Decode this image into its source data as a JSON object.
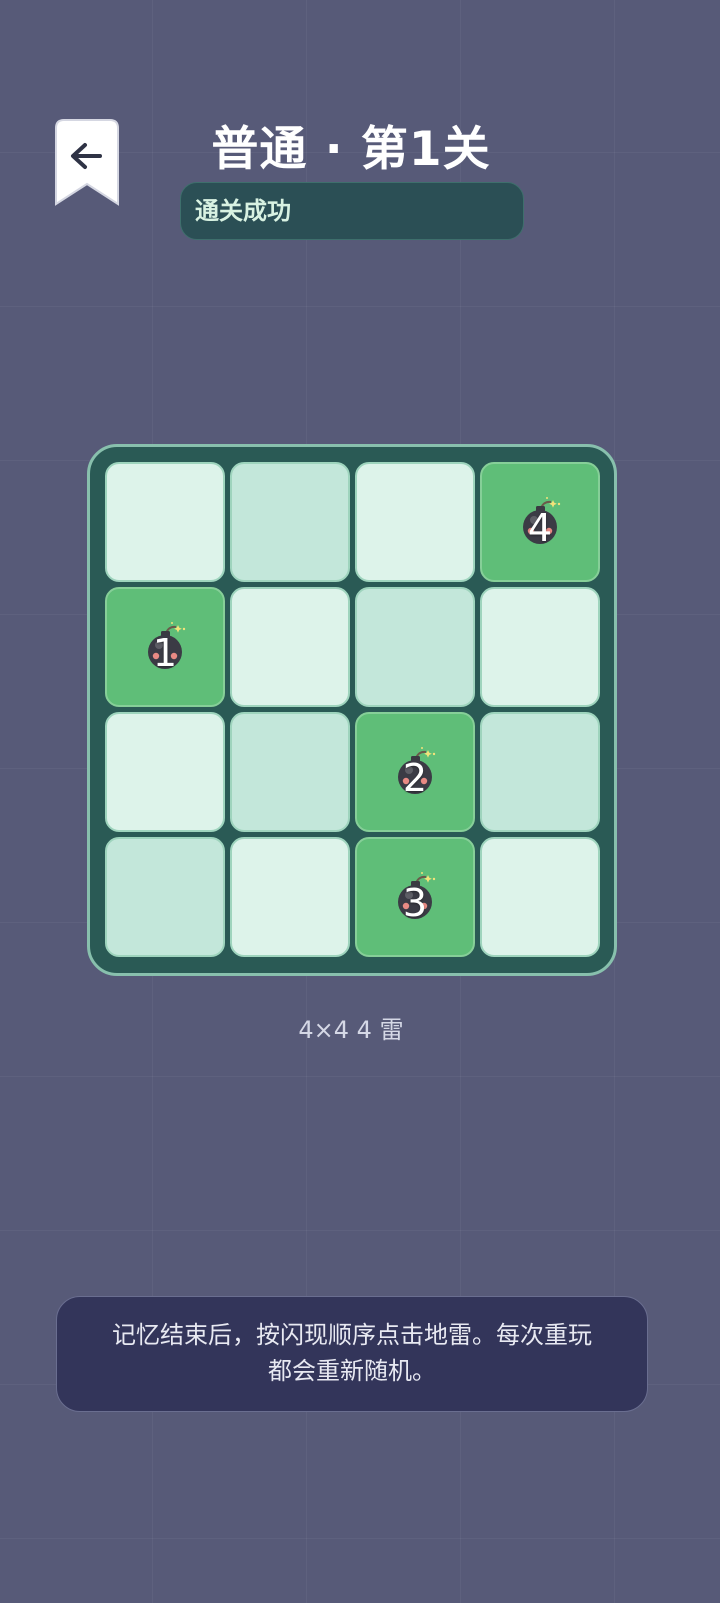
{
  "header": {
    "back_icon": "arrow-left-icon",
    "title": "普通 · 第1关",
    "status": "通关成功"
  },
  "board": {
    "rows": 4,
    "cols": 4,
    "cells": [
      [
        {
          "tone": "light"
        },
        {
          "tone": "mid"
        },
        {
          "tone": "light"
        },
        {
          "tone": "mine",
          "order": "4"
        }
      ],
      [
        {
          "tone": "mine",
          "order": "1"
        },
        {
          "tone": "light"
        },
        {
          "tone": "mid"
        },
        {
          "tone": "light"
        }
      ],
      [
        {
          "tone": "light"
        },
        {
          "tone": "mid"
        },
        {
          "tone": "mine",
          "order": "2"
        },
        {
          "tone": "mid"
        }
      ],
      [
        {
          "tone": "mid"
        },
        {
          "tone": "light"
        },
        {
          "tone": "mine",
          "order": "3"
        },
        {
          "tone": "light"
        }
      ]
    ],
    "mine_icon": "bomb-icon"
  },
  "grid_info": "4×4  4 雷",
  "tip": {
    "line1": "记忆结束后，按闪现顺序点击地雷。每次重玩",
    "line2": "都会重新随机。"
  },
  "colors": {
    "background": "#575a78",
    "board_bg": "#2a5a55",
    "cell_light": "#ddf3ea",
    "cell_mid": "#c3e7da",
    "cell_mine": "#5fbe78",
    "status_bg": "#2b4f55",
    "tip_bg": "#33355a"
  }
}
